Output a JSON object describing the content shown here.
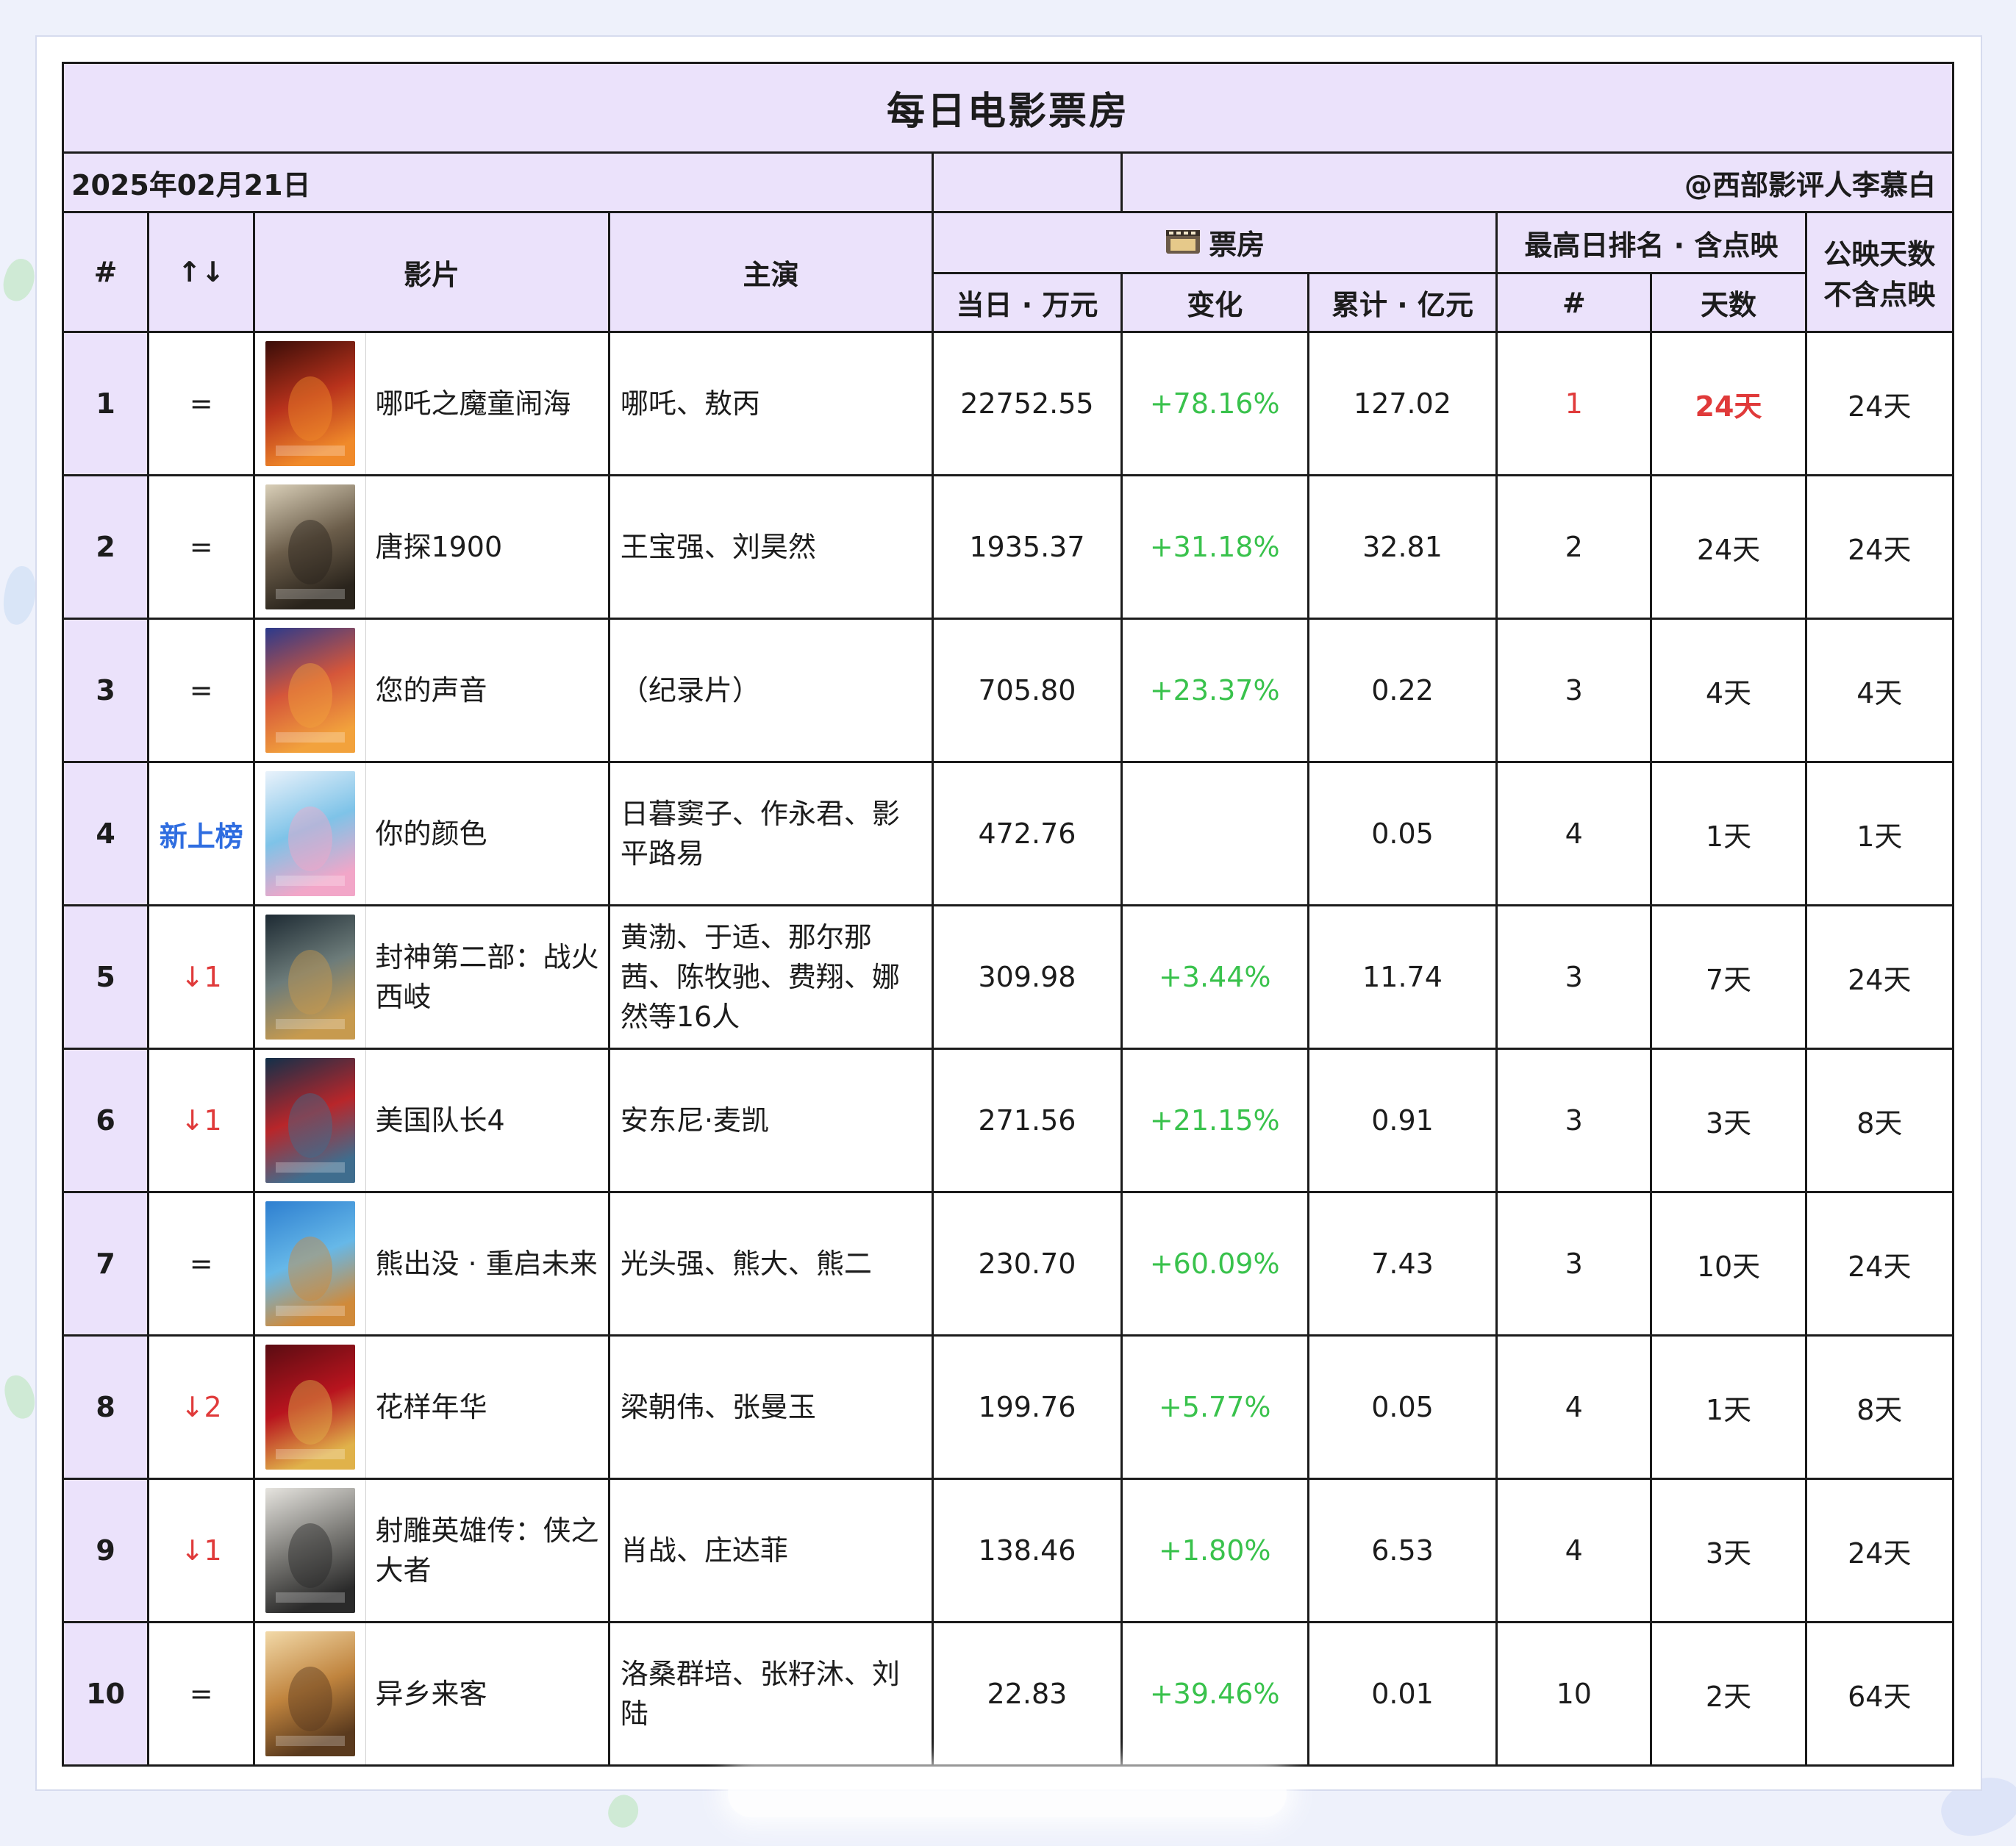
{
  "title": "每日电影票房",
  "date": "2025年02月21日",
  "author": "@西部影评人李慕白",
  "headers": {
    "rank": "#",
    "trend": "↑↓",
    "film": "影片",
    "actors": "主演",
    "box_office": "票房",
    "box_icon": "film-reel-icon",
    "daily": "当日 · 万元",
    "change": "变化",
    "total": "累计 · 亿元",
    "peak": "最高日排名 · 含点映",
    "peak_rank": "#",
    "peak_days": "天数",
    "release_days_line1": "公映天数",
    "release_days_line2": "不含点映"
  },
  "colors": {
    "header_bg": "#ebe2fb",
    "positive": "#39c24c",
    "negative": "#e03a3a",
    "new_entry": "#2f6de0"
  },
  "rows": [
    {
      "rank": "1",
      "trend": "=",
      "trend_type": "same",
      "poster_colors": [
        "#3a0d08",
        "#b8321c",
        "#f08a2a"
      ],
      "name": "哪吒之魔童闹海",
      "actors": "哪吒、敖丙",
      "daily": "22752.55",
      "change": "+78.16%",
      "total": "127.02",
      "peak_rank": "1",
      "peak_days": "24天",
      "release_days": "24天",
      "highlight": true
    },
    {
      "rank": "2",
      "trend": "=",
      "trend_type": "same",
      "poster_colors": [
        "#d9cfb8",
        "#6b5d4a",
        "#2a241c"
      ],
      "name": "唐探1900",
      "actors": "王宝强、刘昊然",
      "daily": "1935.37",
      "change": "+31.18%",
      "total": "32.81",
      "peak_rank": "2",
      "peak_days": "24天",
      "release_days": "24天",
      "highlight": false
    },
    {
      "rank": "3",
      "trend": "=",
      "trend_type": "same",
      "poster_colors": [
        "#2b3a8c",
        "#d5563a",
        "#f2a23c"
      ],
      "name": "您的声音",
      "actors": "（纪录片）",
      "daily": "705.80",
      "change": "+23.37%",
      "total": "0.22",
      "peak_rank": "3",
      "peak_days": "4天",
      "release_days": "4天",
      "highlight": false
    },
    {
      "rank": "4",
      "trend": "新上榜",
      "trend_type": "new",
      "poster_colors": [
        "#e9f2fb",
        "#7ec3e8",
        "#f2a6c8"
      ],
      "name": "你的颜色",
      "actors": "日暮窦子、作永君、影平路易",
      "daily": "472.76",
      "change": "",
      "total": "0.05",
      "peak_rank": "4",
      "peak_days": "1天",
      "release_days": "1天",
      "highlight": false
    },
    {
      "rank": "5",
      "trend": "↓1",
      "trend_type": "down",
      "poster_colors": [
        "#1d2a33",
        "#6d7c7a",
        "#c79a4e"
      ],
      "name": "封神第二部：战火西岐",
      "actors": "黄渤、于适、那尔那茜、陈牧驰、费翔、娜然等16人",
      "daily": "309.98",
      "change": "+3.44%",
      "total": "11.74",
      "peak_rank": "3",
      "peak_days": "7天",
      "release_days": "24天",
      "highlight": false
    },
    {
      "rank": "6",
      "trend": "↓1",
      "trend_type": "down",
      "poster_colors": [
        "#12304a",
        "#b8262a",
        "#3f6d8e"
      ],
      "name": "美国队长4",
      "actors": "安东尼·麦凯",
      "daily": "271.56",
      "change": "+21.15%",
      "total": "0.91",
      "peak_rank": "3",
      "peak_days": "3天",
      "release_days": "8天",
      "highlight": false
    },
    {
      "rank": "7",
      "trend": "=",
      "trend_type": "same",
      "poster_colors": [
        "#2e7fd0",
        "#66b8e8",
        "#d08a3a"
      ],
      "name": "熊出没 · 重启未来",
      "actors": "光头强、熊大、熊二",
      "daily": "230.70",
      "change": "+60.09%",
      "total": "7.43",
      "peak_rank": "3",
      "peak_days": "10天",
      "release_days": "24天",
      "highlight": false
    },
    {
      "rank": "8",
      "trend": "↓2",
      "trend_type": "down",
      "poster_colors": [
        "#5a0c12",
        "#b8141e",
        "#e0b24a"
      ],
      "name": "花样年华",
      "actors": "梁朝伟、张曼玉",
      "daily": "199.76",
      "change": "+5.77%",
      "total": "0.05",
      "peak_rank": "4",
      "peak_days": "1天",
      "release_days": "8天",
      "highlight": false
    },
    {
      "rank": "9",
      "trend": "↓1",
      "trend_type": "down",
      "poster_colors": [
        "#e6e4df",
        "#7b7a76",
        "#2a2a2a"
      ],
      "name": "射雕英雄传：侠之大者",
      "actors": "肖战、庄达菲",
      "daily": "138.46",
      "change": "+1.80%",
      "total": "6.53",
      "peak_rank": "4",
      "peak_days": "3天",
      "release_days": "24天",
      "highlight": false
    },
    {
      "rank": "10",
      "trend": "=",
      "trend_type": "same",
      "poster_colors": [
        "#f2d9a8",
        "#c0843e",
        "#5a3a1e"
      ],
      "name": "异乡来客",
      "actors": "洛桑群培、张籽沐、刘陆",
      "daily": "22.83",
      "change": "+39.46%",
      "total": "0.01",
      "peak_rank": "10",
      "peak_days": "2天",
      "release_days": "64天",
      "highlight": false
    }
  ]
}
